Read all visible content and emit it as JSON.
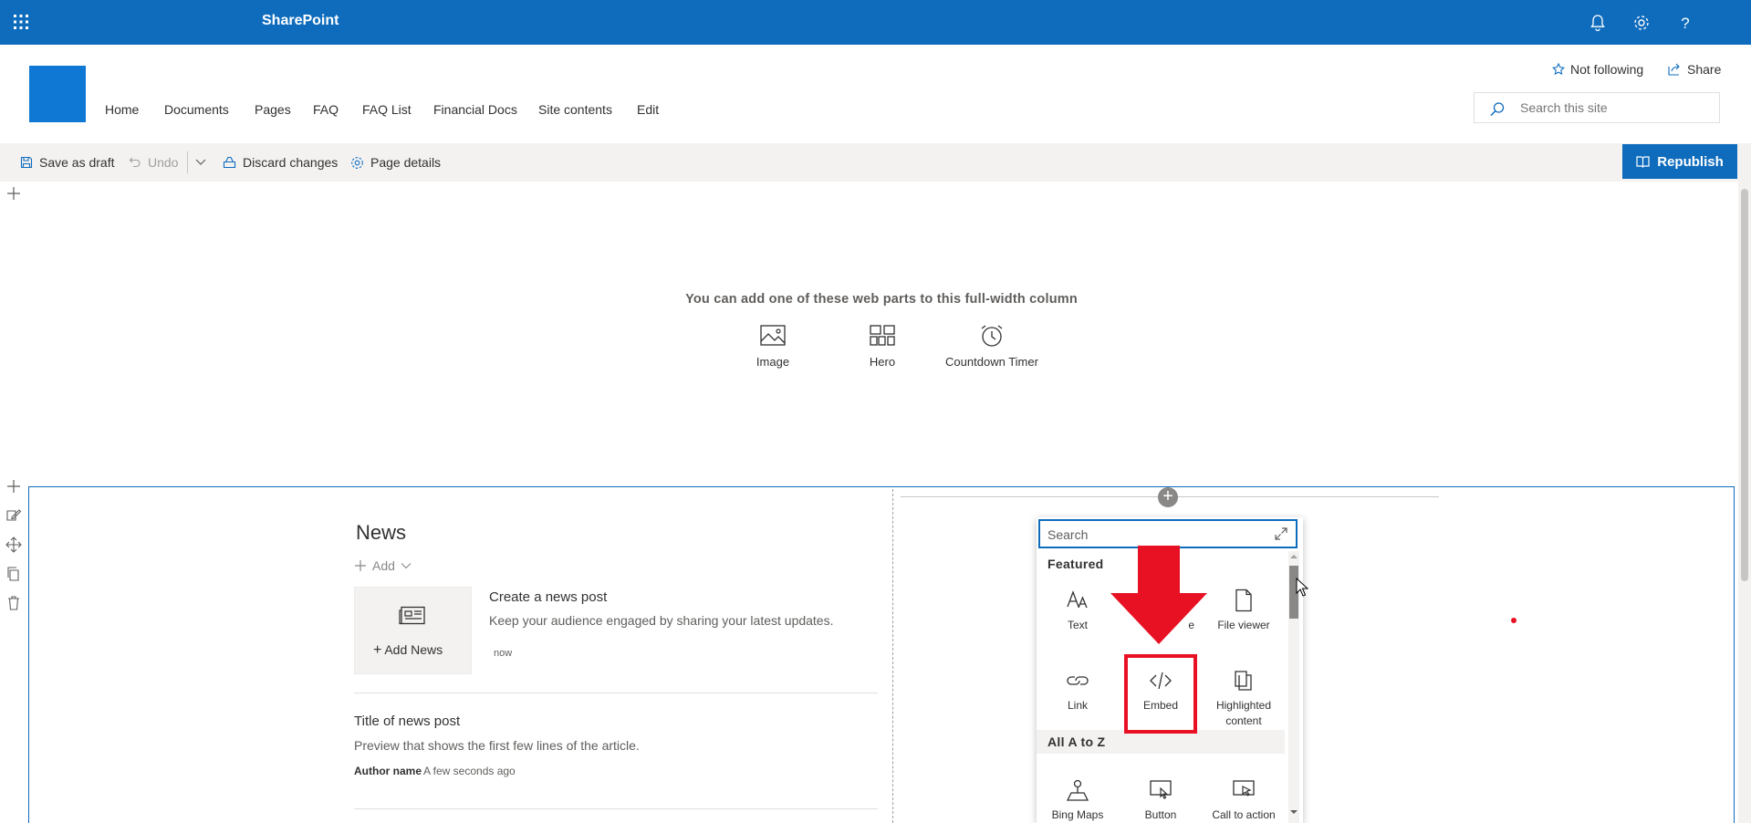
{
  "suitebar": {
    "brand": "SharePoint"
  },
  "site": {
    "nav": [
      "Home",
      "Documents",
      "Pages",
      "FAQ",
      "FAQ List",
      "Financial Docs",
      "Site contents",
      "Edit"
    ],
    "follow_label": "Not following",
    "share_label": "Share",
    "search_placeholder": "Search this site"
  },
  "commandbar": {
    "save_draft": "Save as draft",
    "undo": "Undo",
    "discard": "Discard changes",
    "page_details": "Page details",
    "republish": "Republish"
  },
  "top_section": {
    "prompt": "You can add one of these web parts to this full-width column",
    "options": [
      "Image",
      "Hero",
      "Countdown Timer"
    ]
  },
  "news": {
    "title": "News",
    "add_label": "Add",
    "add_news_label": "Add News",
    "create_title": "Create a news post",
    "create_desc": "Keep your audience engaged by sharing your latest updates.",
    "create_time": "now",
    "post_title": "Title of news post",
    "post_preview": "Preview that shows the first few lines of the article.",
    "post_author": "Author name",
    "post_time": "A few seconds ago"
  },
  "toolbox": {
    "search_placeholder": "Search",
    "featured_heading": "Featured",
    "featured_items": [
      {
        "label": "Text",
        "icon": "text-icon"
      },
      {
        "label": "e",
        "icon": "image-icon"
      },
      {
        "label": "File viewer",
        "icon": "file-viewer-icon"
      },
      {
        "label": "Link",
        "icon": "link-icon"
      },
      {
        "label": "Embed",
        "icon": "embed-icon"
      },
      {
        "label": "Highlighted content",
        "icon": "highlighted-content-icon"
      }
    ],
    "az_heading": "All A to Z",
    "az_items": [
      {
        "label": "Bing Maps",
        "icon": "bing-maps-icon"
      },
      {
        "label": "Button",
        "icon": "button-icon"
      },
      {
        "label": "Call to action",
        "icon": "call-to-action-icon"
      }
    ]
  },
  "colors": {
    "brand": "#0f6cbd",
    "annotation": "#e81123"
  }
}
